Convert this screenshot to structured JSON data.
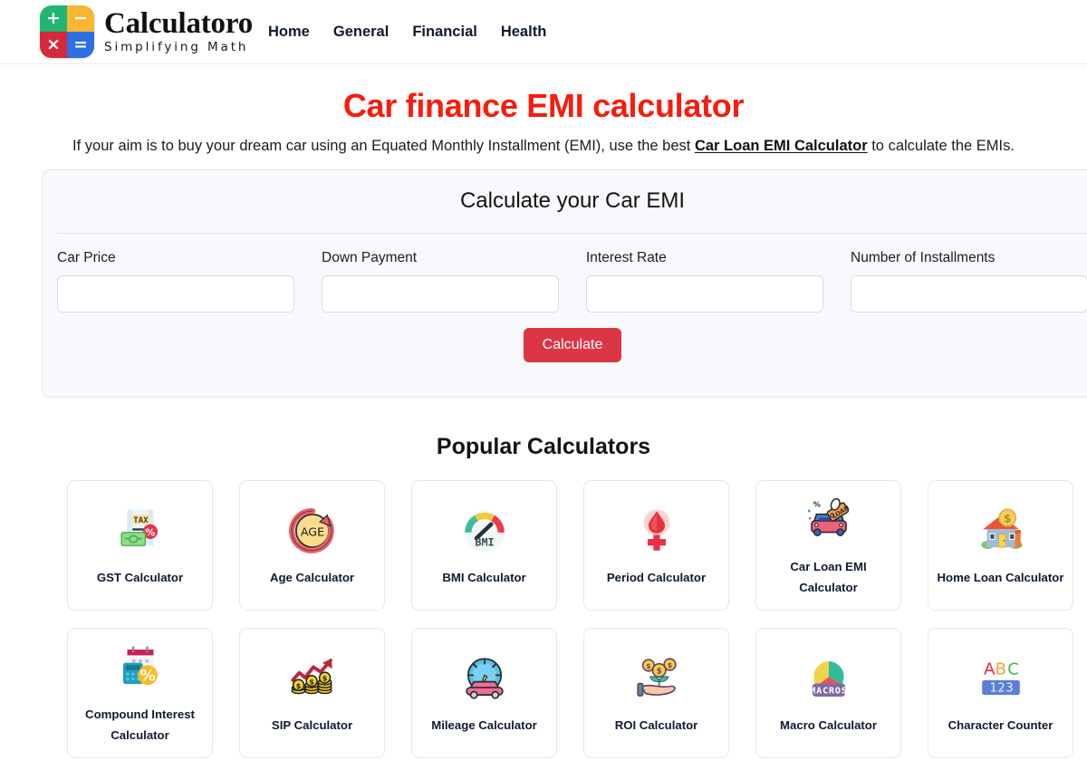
{
  "header": {
    "brand_name": "Calculatoro",
    "brand_tagline": "Simplifying Math",
    "logo": {
      "plus": "+",
      "minus": "−",
      "times": "×",
      "equals": "=",
      "colors": {
        "green": "#21b573",
        "yellow": "#f7b731",
        "red": "#d6283b",
        "blue": "#2f6fe4"
      }
    },
    "nav": [
      {
        "label": "Home"
      },
      {
        "label": "General"
      },
      {
        "label": "Financial"
      },
      {
        "label": "Health"
      }
    ]
  },
  "hero": {
    "title": "Car finance EMI calculator",
    "title_color": "#f81c0c",
    "subtitle_before": "If your aim is to buy your dream car using an Equated Monthly Installment (EMI), use the best ",
    "subtitle_link": "Car Loan EMI Calculator",
    "subtitle_after": " to calculate the EMIs."
  },
  "calculator": {
    "card_title": "Calculate your Car EMI",
    "fields": [
      {
        "label": "Car Price",
        "value": "",
        "placeholder": ""
      },
      {
        "label": "Down Payment",
        "value": "",
        "placeholder": ""
      },
      {
        "label": "Interest Rate",
        "value": "",
        "placeholder": ""
      },
      {
        "label": "Number of Installments",
        "value": "",
        "placeholder": ""
      }
    ],
    "submit_label": "Calculate",
    "submit_color": "#dc3545"
  },
  "popular": {
    "heading": "Popular Calculators",
    "tiles": [
      {
        "label": "GST Calculator",
        "icon": "tax-document-icon"
      },
      {
        "label": "Age Calculator",
        "icon": "age-circle-arrow-icon"
      },
      {
        "label": "BMI Calculator",
        "icon": "bmi-gauge-icon"
      },
      {
        "label": "Period Calculator",
        "icon": "female-blood-drop-icon"
      },
      {
        "label": "Car Loan EMI Calculator",
        "icon": "car-loan-tag-icon"
      },
      {
        "label": "Home Loan Calculator",
        "icon": "house-dollar-icon"
      },
      {
        "label": "Compound Interest Calculator",
        "icon": "calendar-calculator-percent-icon"
      },
      {
        "label": "SIP Calculator",
        "icon": "growth-arrow-coins-icon"
      },
      {
        "label": "Mileage Calculator",
        "icon": "speedometer-car-icon"
      },
      {
        "label": "ROI Calculator",
        "icon": "hand-coin-plant-icon"
      },
      {
        "label": "Macro Calculator",
        "icon": "macros-pie-icon"
      },
      {
        "label": "Character Counter",
        "icon": "abc-123-icon"
      }
    ]
  }
}
